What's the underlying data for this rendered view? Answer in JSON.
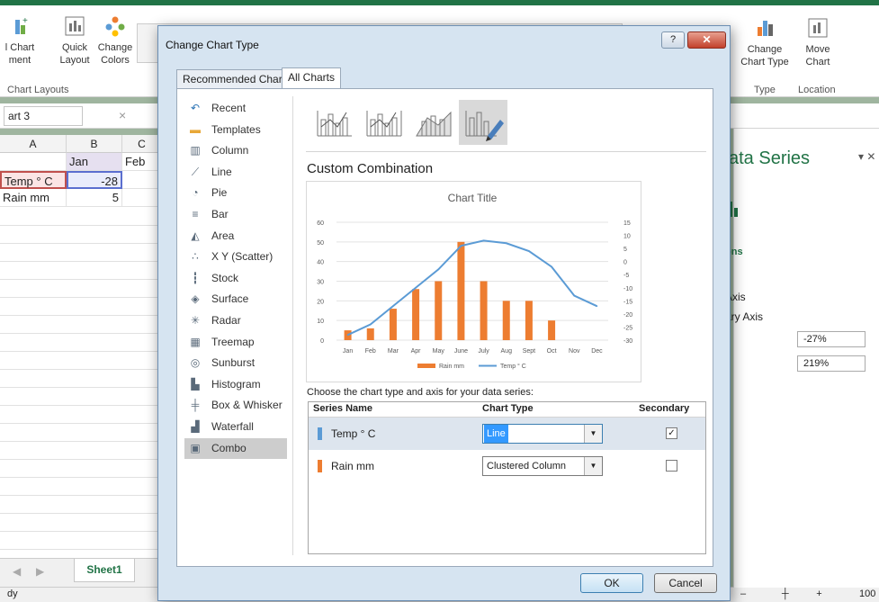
{
  "ribbon": {
    "chart_element_label": "l Chart\nment",
    "quick_layout_label": "Quick\nLayout",
    "change_colors_label": "Change\nColors",
    "chart_layouts_group": "Chart Layouts",
    "change_chart_type_label": "Change\nChart Type",
    "move_chart_label": "Move\nChart",
    "type_group": "Type",
    "location_group": "Location"
  },
  "formula_bar": {
    "name_box": "art 3",
    "cancel_glyph": "×"
  },
  "sheet": {
    "col_headers": [
      "A",
      "B",
      "C"
    ],
    "rows": [
      [
        "",
        "Jan",
        "Feb"
      ],
      [
        "Temp ° C",
        "-28",
        ""
      ],
      [
        "Rain mm",
        "5",
        ""
      ]
    ]
  },
  "sheet_tab": "Sheet1",
  "status": "dy",
  "zoom": "100",
  "task_pane": {
    "title": "ata Series",
    "options_heading": "ons",
    "item_n": "n",
    "axis1": "Axis",
    "axis2": "ary Axis",
    "field1": "-27%",
    "field2": "219%"
  },
  "dialog": {
    "title": "Change Chart Type",
    "help": "?",
    "close": "✕",
    "tabs": [
      "Recommended Charts",
      "All Charts"
    ],
    "sidebar": [
      {
        "label": "Recent",
        "icon": "recent-icon"
      },
      {
        "label": "Templates",
        "icon": "templates-icon"
      },
      {
        "label": "Column",
        "icon": "column-chart-icon"
      },
      {
        "label": "Line",
        "icon": "line-chart-icon"
      },
      {
        "label": "Pie",
        "icon": "pie-chart-icon"
      },
      {
        "label": "Bar",
        "icon": "bar-chart-icon"
      },
      {
        "label": "Area",
        "icon": "area-chart-icon"
      },
      {
        "label": "X Y (Scatter)",
        "icon": "scatter-chart-icon"
      },
      {
        "label": "Stock",
        "icon": "stock-chart-icon"
      },
      {
        "label": "Surface",
        "icon": "surface-chart-icon"
      },
      {
        "label": "Radar",
        "icon": "radar-chart-icon"
      },
      {
        "label": "Treemap",
        "icon": "treemap-icon"
      },
      {
        "label": "Sunburst",
        "icon": "sunburst-icon"
      },
      {
        "label": "Histogram",
        "icon": "histogram-icon"
      },
      {
        "label": "Box & Whisker",
        "icon": "box-whisker-icon"
      },
      {
        "label": "Waterfall",
        "icon": "waterfall-icon"
      },
      {
        "label": "Combo",
        "icon": "combo-chart-icon",
        "selected": true
      }
    ],
    "custom_title": "Custom Combination",
    "choose_label": "Choose the chart type and axis for your data series:",
    "table_headers": {
      "series": "Series Name",
      "type": "Chart Type",
      "axis": "Secondary Axis"
    },
    "series_rows": [
      {
        "name": "Temp ° C",
        "type": "Line",
        "secondary": true,
        "color": "#5b9bd5"
      },
      {
        "name": "Rain mm",
        "type": "Clustered Column",
        "secondary": false,
        "color": "#ed7d31"
      }
    ],
    "ok": "OK",
    "cancel": "Cancel"
  },
  "chart_data": {
    "type": "bar",
    "title": "Chart Title",
    "categories": [
      "Jan",
      "Feb",
      "Mar",
      "Apr",
      "May",
      "June",
      "July",
      "Aug",
      "Sept",
      "Oct",
      "Nov",
      "Dec"
    ],
    "left_ticks": [
      "0",
      "10",
      "20",
      "30",
      "40",
      "50",
      "60"
    ],
    "right_ticks": [
      "15",
      "10",
      "5",
      "0",
      "-5",
      "-10",
      "-15",
      "-20",
      "-25",
      "-30"
    ],
    "ylim": [
      0,
      60
    ],
    "y2lim": [
      -30,
      15
    ],
    "series": [
      {
        "name": "Rain mm",
        "kind": "column",
        "axis": "primary",
        "color": "#ed7d31",
        "values": [
          5,
          6,
          16,
          26,
          30,
          50,
          30,
          20,
          20,
          10,
          null,
          null
        ]
      },
      {
        "name": "Temp ° C",
        "kind": "line",
        "axis": "secondary",
        "color": "#5b9bd5",
        "values": [
          -28,
          -24,
          -17,
          -10,
          -3,
          6,
          8,
          7,
          4,
          -2,
          -13,
          -17
        ]
      }
    ],
    "legend": "bottom",
    "grid": true
  }
}
